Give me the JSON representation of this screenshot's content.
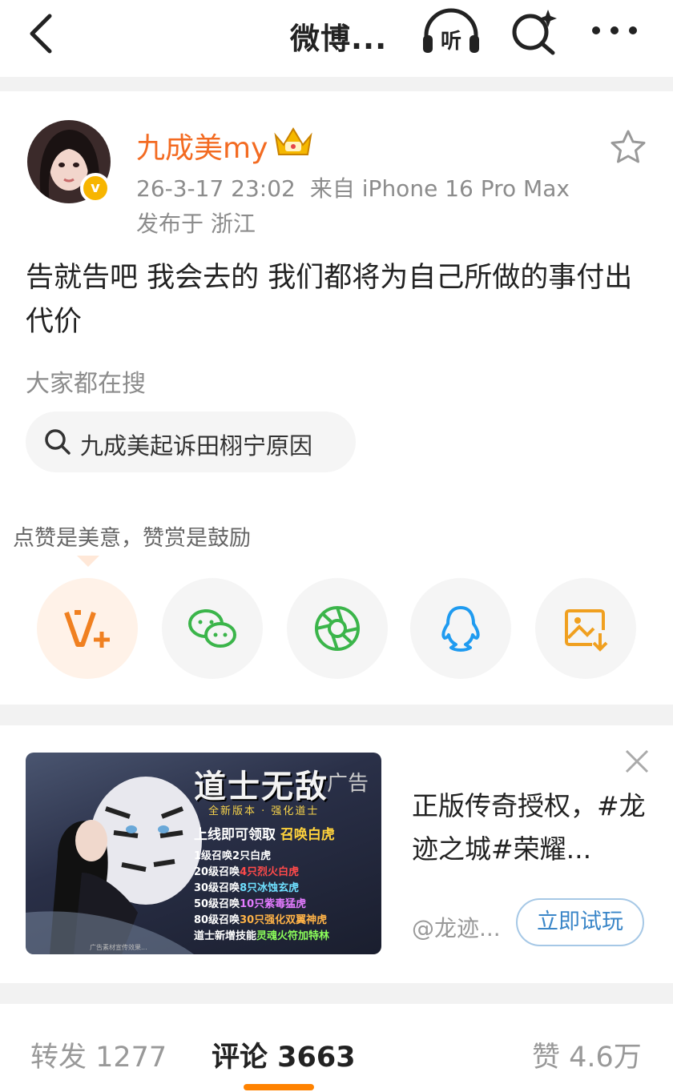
{
  "nav": {
    "title": "微博...",
    "listen_label": "听"
  },
  "post": {
    "username": "九成美my",
    "time": "26-3-17 23:02",
    "source": "来自 iPhone 16 Pro Max",
    "location": "发布于 浙江",
    "verified_badge": "v",
    "content": "告就告吧 我会去的 我们都将为自己所做的事付出代价"
  },
  "hot_search": {
    "label": "大家都在搜",
    "query": "九成美起诉田栩宁原因"
  },
  "reward": {
    "tip": "点赞是美意，赞赏是鼓励",
    "share_targets": [
      "v-plus-icon",
      "wechat-icon",
      "moments-icon",
      "qq-icon",
      "save-image-icon"
    ]
  },
  "ad": {
    "image": {
      "title": "道士无敌",
      "tag": "广告",
      "subtitle": "全新版本 · 强化道士",
      "headline_a": "上线即可领取",
      "headline_b": "召唤白虎",
      "lines": [
        {
          "a": "1级召唤",
          "b": "2只白虎",
          "c": "",
          "cls": ""
        },
        {
          "a": "20级召唤",
          "b": "4只烈火白虎",
          "cls": "r"
        },
        {
          "a": "30级召唤",
          "b": "8只冰蚀玄虎",
          "cls": "c"
        },
        {
          "a": "50级召唤",
          "b": "10只紫毒猛虎",
          "cls": "p"
        },
        {
          "a": "80级召唤",
          "b": "30只强化双翼神虎",
          "cls": "o"
        },
        {
          "a": "道士新增技能",
          "b": "灵魂火符加特林",
          "cls": "g"
        }
      ],
      "fine_print": "广告素材宣传效果..."
    },
    "text": "正版传奇授权，#龙迹之城#荣耀...",
    "handle": "@龙迹...",
    "cta": "立即试玩"
  },
  "tabs": {
    "repost": "转发 1277",
    "comment": "评论 3663",
    "like": "赞 4.6万"
  },
  "colors": {
    "accent_orange": "#ff8200",
    "username_orange": "#f36b22",
    "cta_blue": "#3a86c8"
  }
}
